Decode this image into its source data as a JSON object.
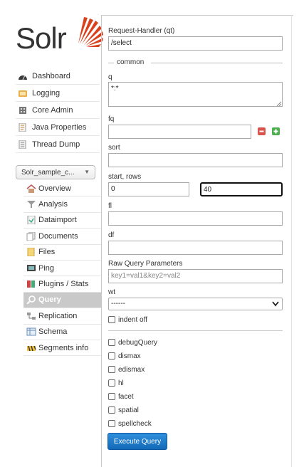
{
  "logo": {
    "text": "Solr",
    "accent_color": "#d9411e"
  },
  "main_nav": [
    {
      "name": "dashboard",
      "label": "Dashboard",
      "icon": "dashboard-icon"
    },
    {
      "name": "logging",
      "label": "Logging",
      "icon": "logging-icon"
    },
    {
      "name": "core-admin",
      "label": "Core Admin",
      "icon": "core-admin-icon"
    },
    {
      "name": "java-properties",
      "label": "Java Properties",
      "icon": "java-properties-icon"
    },
    {
      "name": "thread-dump",
      "label": "Thread Dump",
      "icon": "thread-dump-icon"
    }
  ],
  "core_selector": {
    "value": "Solr_sample_c..."
  },
  "core_nav": [
    {
      "name": "overview",
      "label": "Overview"
    },
    {
      "name": "analysis",
      "label": "Analysis"
    },
    {
      "name": "dataimport",
      "label": "Dataimport"
    },
    {
      "name": "documents",
      "label": "Documents"
    },
    {
      "name": "files",
      "label": "Files"
    },
    {
      "name": "ping",
      "label": "Ping"
    },
    {
      "name": "plugins-stats",
      "label": "Plugins / Stats"
    },
    {
      "name": "query",
      "label": "Query",
      "active": true
    },
    {
      "name": "replication",
      "label": "Replication"
    },
    {
      "name": "schema",
      "label": "Schema"
    },
    {
      "name": "segments-info",
      "label": "Segments info"
    }
  ],
  "form": {
    "request_handler": {
      "label": "Request-Handler (qt)",
      "value": "/select"
    },
    "common_legend": "common",
    "q": {
      "label": "q",
      "value": "*:*"
    },
    "fq": {
      "label": "fq",
      "value": ""
    },
    "sort": {
      "label": "sort",
      "value": ""
    },
    "start_rows": {
      "label": "start, rows",
      "start": "0",
      "rows": "40"
    },
    "fl": {
      "label": "fl",
      "value": ""
    },
    "df": {
      "label": "df",
      "value": ""
    },
    "raw": {
      "label": "Raw Query Parameters",
      "placeholder": "key1=val1&key2=val2"
    },
    "wt": {
      "label": "wt",
      "value": "------"
    },
    "indent": {
      "label": "indent off",
      "checked": false
    },
    "options": [
      {
        "name": "debugquery",
        "label": "debugQuery"
      },
      {
        "name": "dismax",
        "label": "dismax"
      },
      {
        "name": "edismax",
        "label": "edismax"
      },
      {
        "name": "hl",
        "label": "hl"
      },
      {
        "name": "facet",
        "label": "facet"
      },
      {
        "name": "spatial",
        "label": "spatial"
      },
      {
        "name": "spellcheck",
        "label": "spellcheck"
      }
    ],
    "execute_label": "Execute Query"
  }
}
